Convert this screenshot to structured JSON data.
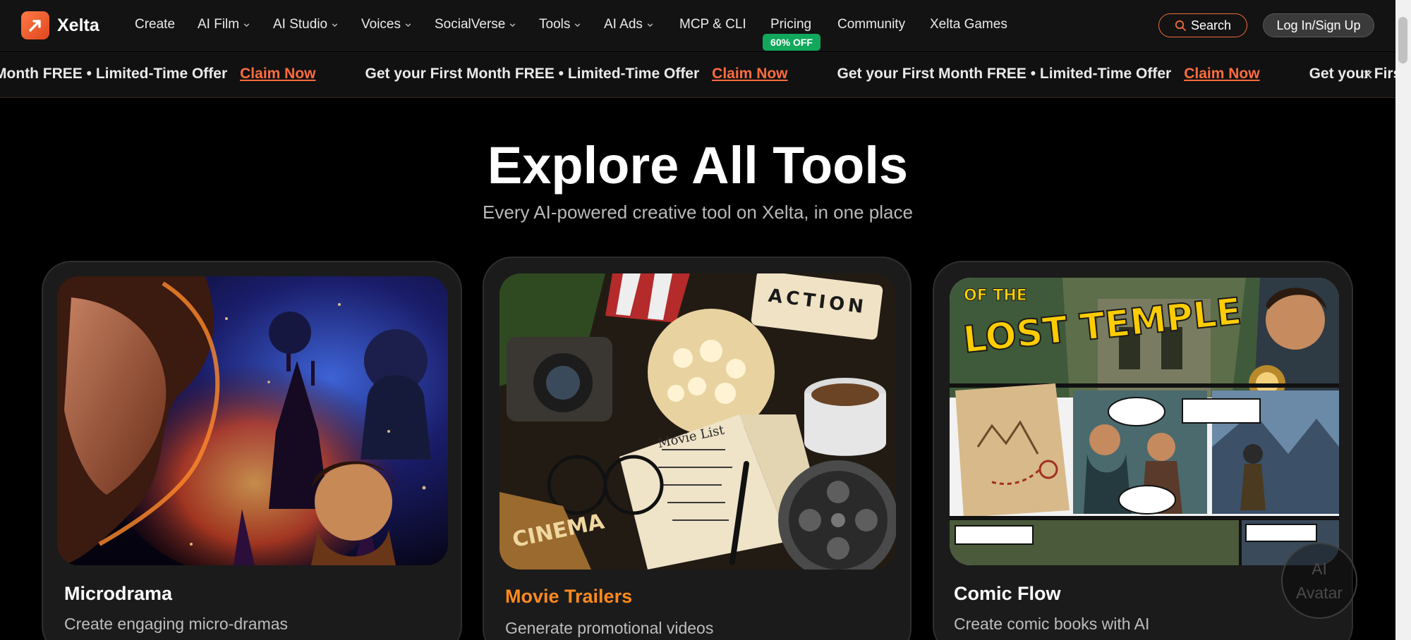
{
  "brand": {
    "name": "Xelta",
    "accent": "#f06a3a"
  },
  "nav": {
    "items": [
      {
        "label": "Create",
        "dropdown": false
      },
      {
        "label": "AI Film",
        "dropdown": true
      },
      {
        "label": "AI Studio",
        "dropdown": true
      },
      {
        "label": "Voices",
        "dropdown": true
      },
      {
        "label": "SocialVerse",
        "dropdown": true
      },
      {
        "label": "Tools",
        "dropdown": true
      },
      {
        "label": "AI Ads",
        "dropdown": true
      },
      {
        "label": "MCP & CLI",
        "dropdown": false
      },
      {
        "label": "Pricing",
        "dropdown": false
      },
      {
        "label": "Community",
        "dropdown": false
      },
      {
        "label": "Xelta Games",
        "dropdown": false
      }
    ],
    "pricing_badge": "60% OFF",
    "search_label": "Search",
    "login_label": "Log In/Sign Up"
  },
  "promo": {
    "text": "Get your First Month FREE • Limited-Time Offer",
    "first_text": "Month FREE • Limited-Time Offer",
    "last_text": "Get your First M",
    "link_label": "Claim Now",
    "close_glyph": "×"
  },
  "hero": {
    "title": "Explore All Tools",
    "subtitle": "Every AI-powered creative tool on Xelta, in one place"
  },
  "cards": [
    {
      "title": "Microdrama",
      "description": "Create engaging micro-dramas",
      "active": false
    },
    {
      "title": "Movie Trailers",
      "description": "Generate promotional videos",
      "active": true
    },
    {
      "title": "Comic Flow",
      "description": "Create comic books with AI",
      "active": false
    }
  ],
  "comic_art": {
    "headline_top": "OF THE",
    "headline_main": "LOST TEMPLE"
  },
  "avatar": {
    "line1": "AI",
    "line2": "Avatar"
  }
}
